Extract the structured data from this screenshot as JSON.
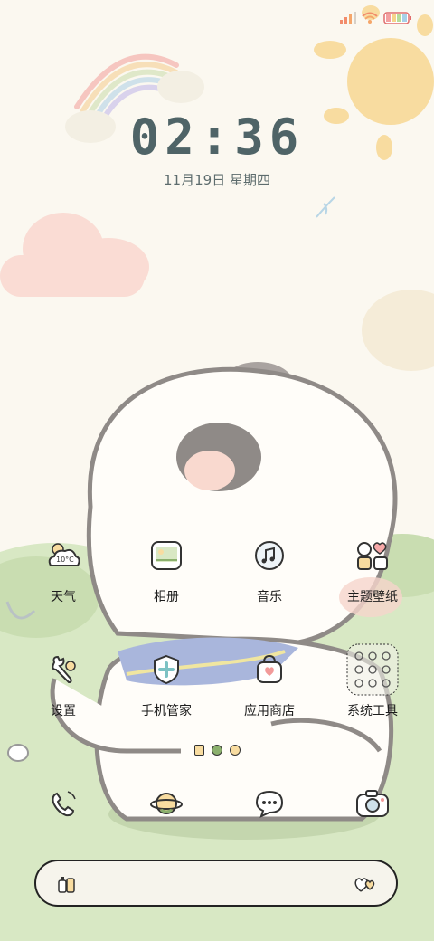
{
  "status_bar": {
    "signal_icon": "signal-bars-icon",
    "wifi_icon": "wifi-icon",
    "battery_icon": "battery-icon"
  },
  "lockscreen": {
    "time": "02:36",
    "date": "11月19日 星期四"
  },
  "weather_widget": {
    "temperature": "10°C"
  },
  "apps": [
    {
      "label": "天气",
      "icon": "weather-cloud-icon"
    },
    {
      "label": "相册",
      "icon": "gallery-icon"
    },
    {
      "label": "音乐",
      "icon": "music-icon"
    },
    {
      "label": "主题壁纸",
      "icon": "theme-icon"
    },
    {
      "label": "设置",
      "icon": "settings-wrench-icon"
    },
    {
      "label": "手机管家",
      "icon": "phone-manager-shield-icon"
    },
    {
      "label": "应用商店",
      "icon": "app-store-bag-icon"
    },
    {
      "label": "系统工具",
      "icon": "system-tools-folder-icon"
    }
  ],
  "page_indicator": {
    "pages": 3,
    "current": 1
  },
  "dock": [
    {
      "icon": "phone-icon"
    },
    {
      "icon": "browser-planet-icon"
    },
    {
      "icon": "messages-bubble-icon"
    },
    {
      "icon": "camera-icon"
    }
  ],
  "search_bar": {
    "left_icon": "search-bottles-icon",
    "right_icon": "hearts-icon"
  },
  "colors": {
    "background": "#fbf8f0",
    "clock_text": "#4f6467",
    "grass": "#d8e8c4",
    "sun": "#f8dca0",
    "cloud_pink": "#fadcd4"
  }
}
